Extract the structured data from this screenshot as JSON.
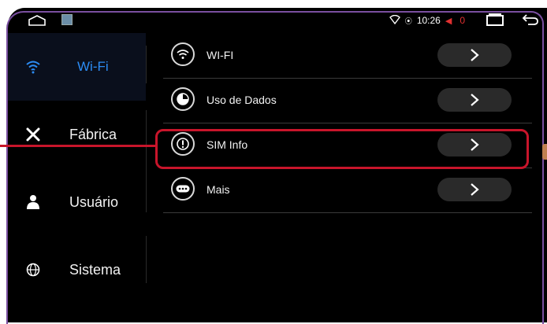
{
  "statusbar": {
    "time": "10:26",
    "alert_count": "0",
    "icons": [
      "home-icon",
      "image-icon",
      "wifi-icon",
      "location-icon",
      "mute-icon",
      "recent-apps-icon",
      "back-icon"
    ]
  },
  "sidebar": {
    "items": [
      {
        "label": "Wi-Fi",
        "icon": "wifi-icon",
        "active": true
      },
      {
        "label": "Fábrica",
        "icon": "tools-icon",
        "active": false
      },
      {
        "label": "Usuário",
        "icon": "user-icon",
        "active": false
      },
      {
        "label": "Sistema",
        "icon": "globe-icon",
        "active": false
      }
    ]
  },
  "main": {
    "rows": [
      {
        "label": "WI-FI",
        "icon": "wifi-icon"
      },
      {
        "label": "Uso de Dados",
        "icon": "data-usage-icon"
      },
      {
        "label": "SIM Info",
        "icon": "info-icon"
      },
      {
        "label": "Mais",
        "icon": "more-icon"
      }
    ]
  },
  "colors": {
    "accent": "#2c8cf4",
    "highlight": "#c8152b",
    "frame": "#7a4fa0"
  }
}
